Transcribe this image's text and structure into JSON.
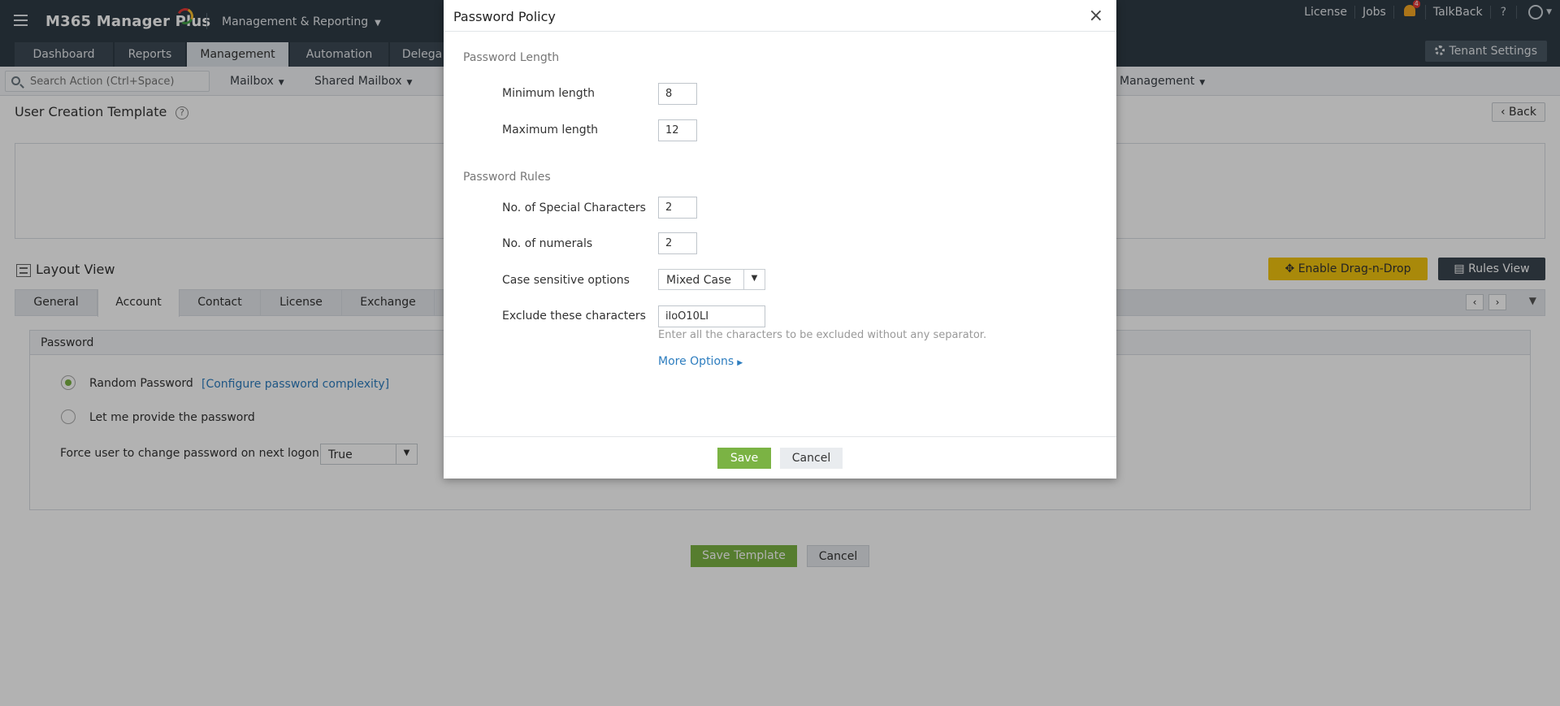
{
  "app": {
    "brand": "M365 Manager Plus",
    "module_switch": "Management & Reporting"
  },
  "topbar_right": {
    "license": "License",
    "jobs": "Jobs",
    "notification_count": "4",
    "talkback": "TalkBack",
    "help": "?"
  },
  "main_tabs": [
    {
      "label": "Dashboard"
    },
    {
      "label": "Reports"
    },
    {
      "label": "Management"
    },
    {
      "label": "Automation"
    },
    {
      "label": "Delega"
    }
  ],
  "tenant_settings": "Tenant Settings",
  "actionbar": {
    "search_placeholder": "Search Action (Ctrl+Space)",
    "menus": [
      "Mailbox",
      "Shared Mailbox",
      "Management"
    ]
  },
  "page": {
    "title": "User Creation Template",
    "help": "?",
    "back": "Back",
    "layout_title": "Layout View",
    "enable_dnd": "Enable Drag-n-Drop",
    "rules_view": "Rules View",
    "form_tabs": [
      {
        "label": "General"
      },
      {
        "label": "Account"
      },
      {
        "label": "Contact"
      },
      {
        "label": "License"
      },
      {
        "label": "Exchange"
      }
    ],
    "password_section": {
      "title": "Password",
      "random_password": "Random Password",
      "configure_link": "[Configure password complexity]",
      "let_me_provide": "Let me provide the password",
      "force_change_label": "Force user to change password on next logon",
      "force_change_value": "True"
    },
    "save_template": "Save Template",
    "cancel": "Cancel"
  },
  "modal": {
    "title": "Password Policy",
    "close": "×",
    "length_section": "Password Length",
    "min_length_label": "Minimum length",
    "min_length_value": "8",
    "max_length_label": "Maximum length",
    "max_length_value": "12",
    "rules_section": "Password Rules",
    "special_chars_label": "No. of Special Characters",
    "special_chars_value": "2",
    "numerals_label": "No. of numerals",
    "numerals_value": "2",
    "case_label": "Case sensitive options",
    "case_value": "Mixed Case",
    "exclude_label": "Exclude these characters",
    "exclude_value": "iloO10LI",
    "exclude_hint": "Enter all the characters to be excluded without any separator.",
    "more_options": "More Options",
    "save": "Save",
    "cancel": "Cancel"
  },
  "colors": {
    "topbar": "#2f3b45",
    "accent_green": "#7bb344",
    "dnd_yellow": "#f2c40f",
    "link_blue": "#2d7dbf"
  },
  "icons": [
    "hamburger-icon",
    "bell-icon",
    "user-icon",
    "gear-icon",
    "search-icon",
    "help-icon",
    "layout-icon",
    "close-icon",
    "chevron-down-icon",
    "move-icon",
    "document-icon"
  ]
}
